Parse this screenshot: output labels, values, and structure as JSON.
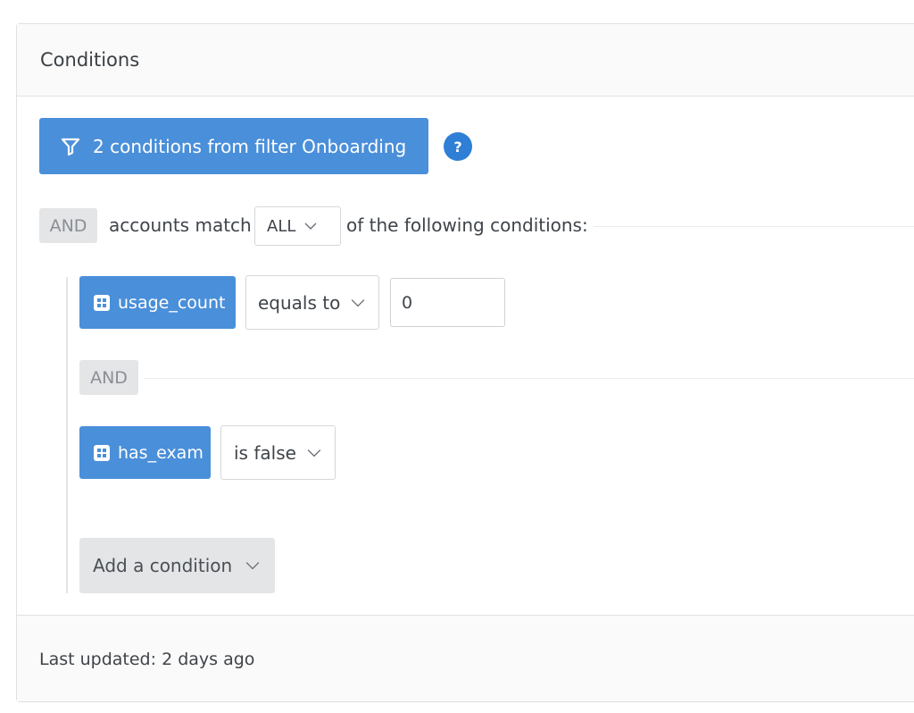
{
  "panel": {
    "title": "Conditions"
  },
  "filter_button": {
    "label": "2 conditions from filter Onboarding",
    "icon": "funnel-icon"
  },
  "help": {
    "label": "?"
  },
  "top_group": {
    "operator": "AND",
    "prefix": "accounts match",
    "match_select": "ALL",
    "suffix": "of the following conditions:"
  },
  "conditions": [
    {
      "field": "usage_count",
      "operator": "equals to",
      "value": "0"
    },
    {
      "field": "has_exam",
      "operator": "is false"
    }
  ],
  "inner_operator": "AND",
  "add_condition": {
    "label": "Add a condition"
  },
  "footer": {
    "text": "Last updated: 2 days ago"
  },
  "colors": {
    "accent": "#4a8fd9",
    "help": "#2f7fd6",
    "badge_bg": "#e4e5e7"
  }
}
